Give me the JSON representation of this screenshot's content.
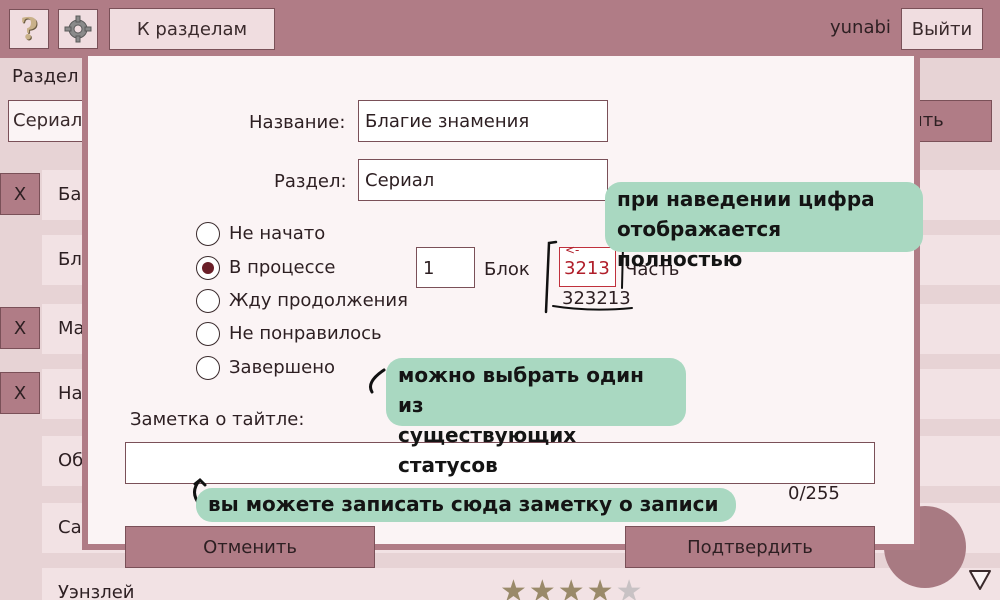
{
  "topbar": {
    "help_icon": "question-mark-icon",
    "settings_icon": "gear-icon",
    "back_label": "К разделам",
    "username": "yunabi",
    "logout_label": "Выйти",
    "bg_color": "#b07c86"
  },
  "background": {
    "section_label": "Раздел",
    "section_value": "Сериал",
    "apply_label": "ить",
    "rows": [
      {
        "label": "Ба",
        "has_delete": true
      },
      {
        "label": "Бл",
        "has_delete": false
      },
      {
        "label": "Ма",
        "has_delete": true
      },
      {
        "label": "На",
        "has_delete": true
      },
      {
        "label": "Об",
        "has_delete": false
      },
      {
        "label": "Са",
        "has_delete": false
      },
      {
        "label": "Уэнзлей",
        "has_delete": false
      }
    ],
    "delete_label": "X",
    "stars": "★★★★",
    "star_empty": "★",
    "rating": 4,
    "rating_max": 5
  },
  "modal": {
    "name_label": "Название:",
    "name_value": "Благие знамения",
    "section_label": "Раздел:",
    "section_value": "Сериал",
    "statuses": [
      {
        "label": "Не начато",
        "checked": false
      },
      {
        "label": "В процессе",
        "checked": true
      },
      {
        "label": "Жду продолжения",
        "checked": false
      },
      {
        "label": "Не понравилось",
        "checked": false
      },
      {
        "label": "Завершено",
        "checked": false
      }
    ],
    "block_value": "1",
    "block_label": "Блок",
    "part_value": "3213",
    "part_arrow": "<-",
    "part_full": "323213",
    "part_label": "Часть",
    "note_label": "Заметка о тайтле:",
    "note_value": "",
    "counter": "0/255",
    "cancel_label": "Отменить",
    "confirm_label": "Подтвердить"
  },
  "annotations": {
    "hover_line1": "при наведении цифра",
    "hover_line2": "отображается полностью",
    "status_line1": "можно выбрать один из",
    "status_line2": "существующих статусов",
    "note_hint": "вы можете записать сюда заметку о записи",
    "bubble_color": "#a9d8c1"
  }
}
